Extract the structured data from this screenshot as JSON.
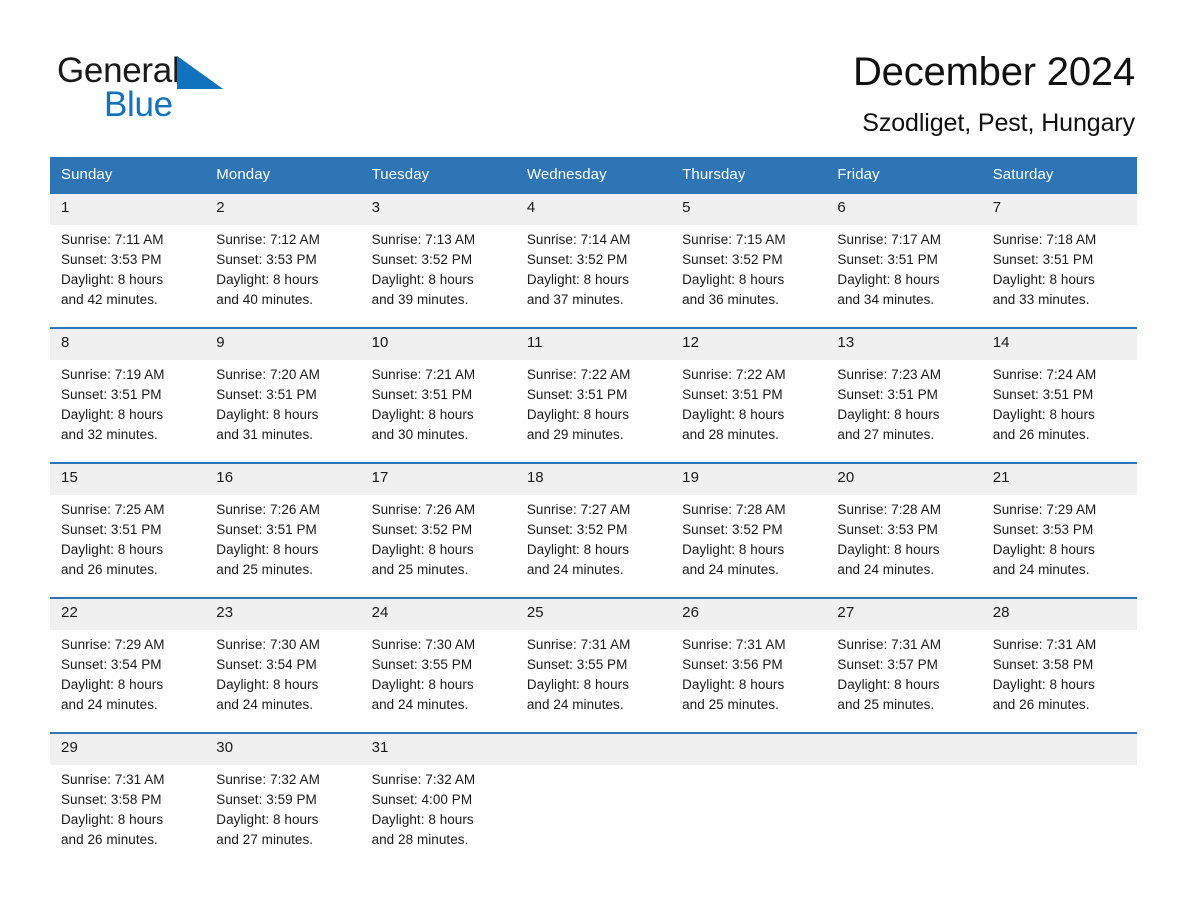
{
  "brand": {
    "name_part1": "General",
    "name_part2": "Blue",
    "triangle_color": "#1173bd",
    "text_color": "#1a1a1a"
  },
  "header": {
    "title": "December 2024",
    "location": "Szodliget, Pest, Hungary"
  },
  "theme": {
    "header_blue": "#2e75b6",
    "daynum_gray": "#f0f0f0",
    "page_background": "#fefefe",
    "text": "#1a1a1a"
  },
  "weekday_headers": [
    "Sunday",
    "Monday",
    "Tuesday",
    "Wednesday",
    "Thursday",
    "Friday",
    "Saturday"
  ],
  "weeks": [
    [
      {
        "day": "1",
        "sunrise": "Sunrise: 7:11 AM",
        "sunset": "Sunset: 3:53 PM",
        "daylight1": "Daylight: 8 hours",
        "daylight2": "and 42 minutes."
      },
      {
        "day": "2",
        "sunrise": "Sunrise: 7:12 AM",
        "sunset": "Sunset: 3:53 PM",
        "daylight1": "Daylight: 8 hours",
        "daylight2": "and 40 minutes."
      },
      {
        "day": "3",
        "sunrise": "Sunrise: 7:13 AM",
        "sunset": "Sunset: 3:52 PM",
        "daylight1": "Daylight: 8 hours",
        "daylight2": "and 39 minutes."
      },
      {
        "day": "4",
        "sunrise": "Sunrise: 7:14 AM",
        "sunset": "Sunset: 3:52 PM",
        "daylight1": "Daylight: 8 hours",
        "daylight2": "and 37 minutes."
      },
      {
        "day": "5",
        "sunrise": "Sunrise: 7:15 AM",
        "sunset": "Sunset: 3:52 PM",
        "daylight1": "Daylight: 8 hours",
        "daylight2": "and 36 minutes."
      },
      {
        "day": "6",
        "sunrise": "Sunrise: 7:17 AM",
        "sunset": "Sunset: 3:51 PM",
        "daylight1": "Daylight: 8 hours",
        "daylight2": "and 34 minutes."
      },
      {
        "day": "7",
        "sunrise": "Sunrise: 7:18 AM",
        "sunset": "Sunset: 3:51 PM",
        "daylight1": "Daylight: 8 hours",
        "daylight2": "and 33 minutes."
      }
    ],
    [
      {
        "day": "8",
        "sunrise": "Sunrise: 7:19 AM",
        "sunset": "Sunset: 3:51 PM",
        "daylight1": "Daylight: 8 hours",
        "daylight2": "and 32 minutes."
      },
      {
        "day": "9",
        "sunrise": "Sunrise: 7:20 AM",
        "sunset": "Sunset: 3:51 PM",
        "daylight1": "Daylight: 8 hours",
        "daylight2": "and 31 minutes."
      },
      {
        "day": "10",
        "sunrise": "Sunrise: 7:21 AM",
        "sunset": "Sunset: 3:51 PM",
        "daylight1": "Daylight: 8 hours",
        "daylight2": "and 30 minutes."
      },
      {
        "day": "11",
        "sunrise": "Sunrise: 7:22 AM",
        "sunset": "Sunset: 3:51 PM",
        "daylight1": "Daylight: 8 hours",
        "daylight2": "and 29 minutes."
      },
      {
        "day": "12",
        "sunrise": "Sunrise: 7:22 AM",
        "sunset": "Sunset: 3:51 PM",
        "daylight1": "Daylight: 8 hours",
        "daylight2": "and 28 minutes."
      },
      {
        "day": "13",
        "sunrise": "Sunrise: 7:23 AM",
        "sunset": "Sunset: 3:51 PM",
        "daylight1": "Daylight: 8 hours",
        "daylight2": "and 27 minutes."
      },
      {
        "day": "14",
        "sunrise": "Sunrise: 7:24 AM",
        "sunset": "Sunset: 3:51 PM",
        "daylight1": "Daylight: 8 hours",
        "daylight2": "and 26 minutes."
      }
    ],
    [
      {
        "day": "15",
        "sunrise": "Sunrise: 7:25 AM",
        "sunset": "Sunset: 3:51 PM",
        "daylight1": "Daylight: 8 hours",
        "daylight2": "and 26 minutes."
      },
      {
        "day": "16",
        "sunrise": "Sunrise: 7:26 AM",
        "sunset": "Sunset: 3:51 PM",
        "daylight1": "Daylight: 8 hours",
        "daylight2": "and 25 minutes."
      },
      {
        "day": "17",
        "sunrise": "Sunrise: 7:26 AM",
        "sunset": "Sunset: 3:52 PM",
        "daylight1": "Daylight: 8 hours",
        "daylight2": "and 25 minutes."
      },
      {
        "day": "18",
        "sunrise": "Sunrise: 7:27 AM",
        "sunset": "Sunset: 3:52 PM",
        "daylight1": "Daylight: 8 hours",
        "daylight2": "and 24 minutes."
      },
      {
        "day": "19",
        "sunrise": "Sunrise: 7:28 AM",
        "sunset": "Sunset: 3:52 PM",
        "daylight1": "Daylight: 8 hours",
        "daylight2": "and 24 minutes."
      },
      {
        "day": "20",
        "sunrise": "Sunrise: 7:28 AM",
        "sunset": "Sunset: 3:53 PM",
        "daylight1": "Daylight: 8 hours",
        "daylight2": "and 24 minutes."
      },
      {
        "day": "21",
        "sunrise": "Sunrise: 7:29 AM",
        "sunset": "Sunset: 3:53 PM",
        "daylight1": "Daylight: 8 hours",
        "daylight2": "and 24 minutes."
      }
    ],
    [
      {
        "day": "22",
        "sunrise": "Sunrise: 7:29 AM",
        "sunset": "Sunset: 3:54 PM",
        "daylight1": "Daylight: 8 hours",
        "daylight2": "and 24 minutes."
      },
      {
        "day": "23",
        "sunrise": "Sunrise: 7:30 AM",
        "sunset": "Sunset: 3:54 PM",
        "daylight1": "Daylight: 8 hours",
        "daylight2": "and 24 minutes."
      },
      {
        "day": "24",
        "sunrise": "Sunrise: 7:30 AM",
        "sunset": "Sunset: 3:55 PM",
        "daylight1": "Daylight: 8 hours",
        "daylight2": "and 24 minutes."
      },
      {
        "day": "25",
        "sunrise": "Sunrise: 7:31 AM",
        "sunset": "Sunset: 3:55 PM",
        "daylight1": "Daylight: 8 hours",
        "daylight2": "and 24 minutes."
      },
      {
        "day": "26",
        "sunrise": "Sunrise: 7:31 AM",
        "sunset": "Sunset: 3:56 PM",
        "daylight1": "Daylight: 8 hours",
        "daylight2": "and 25 minutes."
      },
      {
        "day": "27",
        "sunrise": "Sunrise: 7:31 AM",
        "sunset": "Sunset: 3:57 PM",
        "daylight1": "Daylight: 8 hours",
        "daylight2": "and 25 minutes."
      },
      {
        "day": "28",
        "sunrise": "Sunrise: 7:31 AM",
        "sunset": "Sunset: 3:58 PM",
        "daylight1": "Daylight: 8 hours",
        "daylight2": "and 26 minutes."
      }
    ],
    [
      {
        "day": "29",
        "sunrise": "Sunrise: 7:31 AM",
        "sunset": "Sunset: 3:58 PM",
        "daylight1": "Daylight: 8 hours",
        "daylight2": "and 26 minutes."
      },
      {
        "day": "30",
        "sunrise": "Sunrise: 7:32 AM",
        "sunset": "Sunset: 3:59 PM",
        "daylight1": "Daylight: 8 hours",
        "daylight2": "and 27 minutes."
      },
      {
        "day": "31",
        "sunrise": "Sunrise: 7:32 AM",
        "sunset": "Sunset: 4:00 PM",
        "daylight1": "Daylight: 8 hours",
        "daylight2": "and 28 minutes."
      },
      {
        "day": "",
        "sunrise": "",
        "sunset": "",
        "daylight1": "",
        "daylight2": ""
      },
      {
        "day": "",
        "sunrise": "",
        "sunset": "",
        "daylight1": "",
        "daylight2": ""
      },
      {
        "day": "",
        "sunrise": "",
        "sunset": "",
        "daylight1": "",
        "daylight2": ""
      },
      {
        "day": "",
        "sunrise": "",
        "sunset": "",
        "daylight1": "",
        "daylight2": ""
      }
    ]
  ]
}
